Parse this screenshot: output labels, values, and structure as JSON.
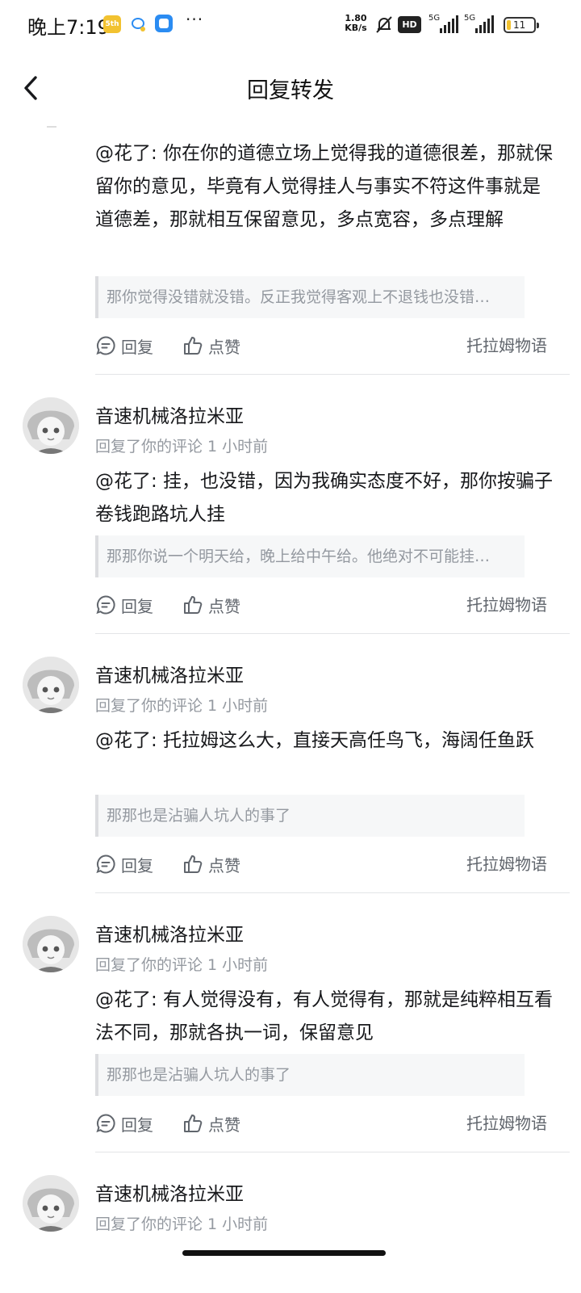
{
  "status_bar": {
    "time": "晚上7:19",
    "app_badge": "5th",
    "network_speed_value": "1.80",
    "network_speed_unit": "KB/s",
    "hd_badge": "HD",
    "signal1_type": "5G",
    "signal2_type": "5G",
    "battery_level": "11",
    "icons": [
      "bilibili-app-icon",
      "qq-app-icon",
      "message-app-icon",
      "more-dots-icon",
      "mute-bell-icon",
      "hd-call-icon",
      "signal-icon",
      "battery-icon"
    ]
  },
  "header": {
    "title": "回复转发",
    "back_icon": "chevron-left-icon"
  },
  "actions": {
    "reply_label": "回复",
    "like_label": "点赞"
  },
  "items": [
    {
      "content": "@花了: 你在你的道德立场上觉得我的道德很差，那就保留你的意见，毕竟有人觉得挂人与事实不符这件事就是道德差，那就相互保留意见，多点宽容，多点理解",
      "quote": "那你觉得没错就没错。反正我觉得客观上不退钱也没错…",
      "source": "托拉姆物语"
    },
    {
      "username": "音速机械洛拉米亚",
      "meta": "回复了你的评论 1 小时前",
      "content": "@花了: 挂，也没错，因为我确实态度不好，那你按骗子卷钱跑路坑人挂",
      "quote": "那那你说一个明天给，晚上给中午给。他绝对不可能挂…",
      "source": "托拉姆物语"
    },
    {
      "username": "音速机械洛拉米亚",
      "meta": "回复了你的评论 1 小时前",
      "content": "@花了: 托拉姆这么大，直接天高任鸟飞，海阔任鱼跃",
      "quote": "那那也是沾骗人坑人的事了",
      "source": "托拉姆物语"
    },
    {
      "username": "音速机械洛拉米亚",
      "meta": "回复了你的评论 1 小时前",
      "content": "@花了: 有人觉得没有，有人觉得有，那就是纯粹相互看法不同，那就各执一词，保留意见",
      "quote": "那那也是沾骗人坑人的事了",
      "source": "托拉姆物语"
    },
    {
      "username": "音速机械洛拉米亚",
      "meta": "回复了你的评论 1 小时前"
    }
  ]
}
